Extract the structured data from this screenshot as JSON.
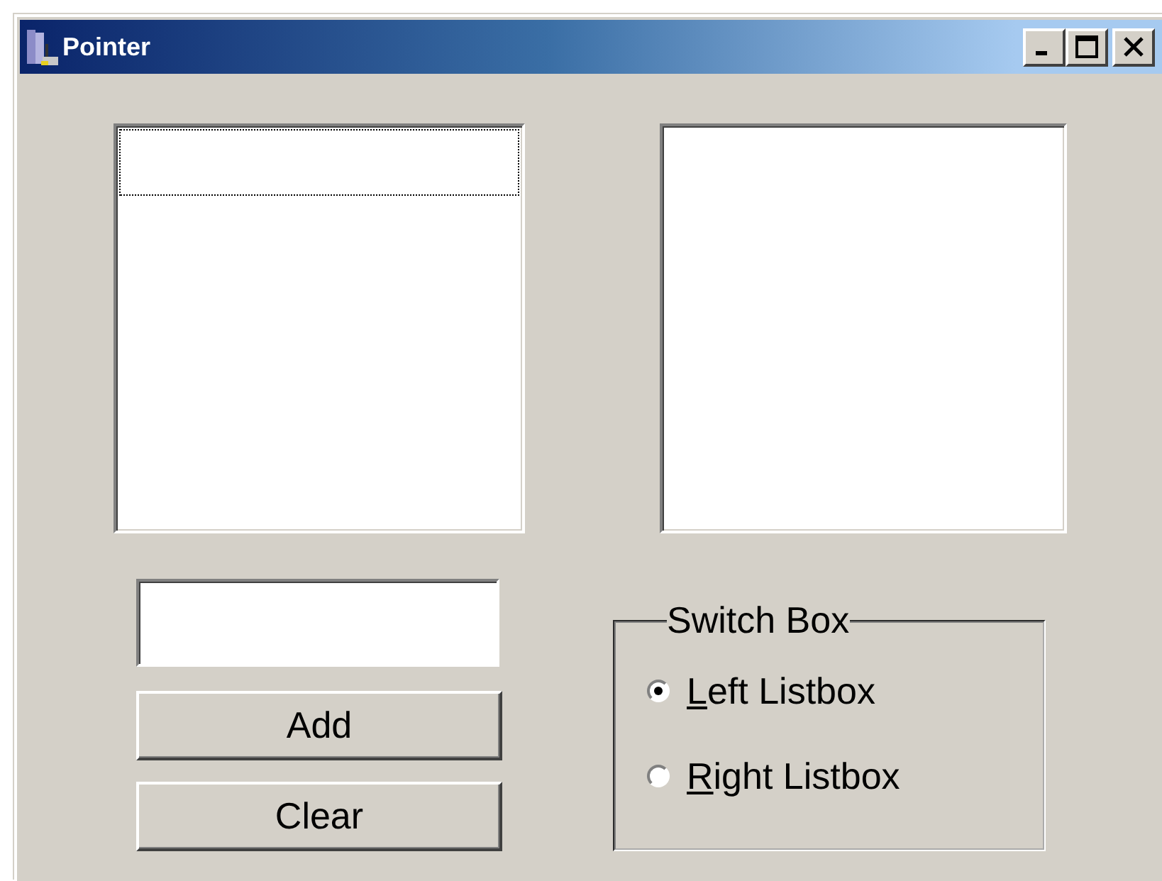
{
  "window": {
    "title": "Pointer"
  },
  "left_listbox": {
    "focused": true
  },
  "right_listbox": {
    "focused": false
  },
  "buttons": [
    {
      "label": "Add"
    },
    {
      "label": "Clear"
    }
  ],
  "switch_box": {
    "title": "Switch Box",
    "options": [
      {
        "label": "Left Listbox",
        "selected": true
      },
      {
        "label": "Right Listbox",
        "selected": false
      }
    ]
  }
}
